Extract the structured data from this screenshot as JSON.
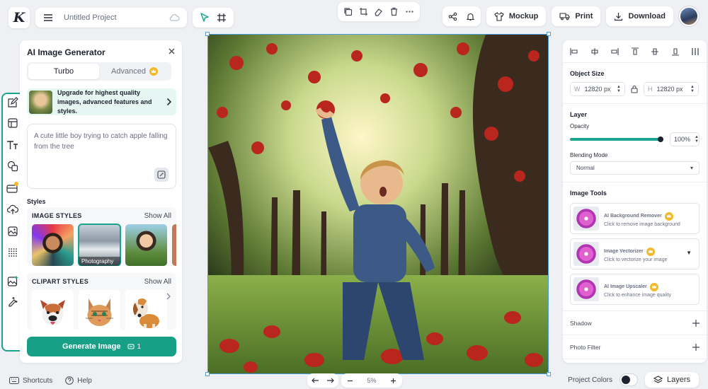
{
  "app": {
    "logo_text": "K",
    "project_name": "Untitled Project"
  },
  "top_actions": {
    "mockup_label": "Mockup",
    "print_label": "Print",
    "download_label": "Download"
  },
  "ai_panel": {
    "title": "AI Image Generator",
    "tabs": [
      {
        "label": "Turbo",
        "active": true
      },
      {
        "label": "Advanced",
        "active": false
      }
    ],
    "upgrade_text": "Upgrade for highest quality images, advanced features and styles.",
    "prompt_text": "A cute little boy trying to catch apple falling from the tree",
    "styles_label": "Styles",
    "image_styles": {
      "title": "IMAGE STYLES",
      "show_all": "Show All",
      "items": [
        {
          "name": "Pop Art"
        },
        {
          "name": "Photography",
          "caption": "Photography",
          "selected": true
        },
        {
          "name": "Anime"
        }
      ]
    },
    "clipart_styles": {
      "title": "CLIPART STYLES",
      "show_all": "Show All",
      "items": [
        {
          "name": "Dog"
        },
        {
          "name": "Cat"
        },
        {
          "name": "Beagle"
        }
      ]
    },
    "generate_label": "Generate Image",
    "credit_count": "1"
  },
  "bottom": {
    "shortcuts_label": "Shortcuts",
    "help_label": "Help",
    "zoom_value": "5%",
    "project_colors_label": "Project Colors",
    "layers_label": "Layers"
  },
  "right_panel": {
    "object_size": {
      "title": "Object Size",
      "w_key": "W",
      "w_value": "12820 px",
      "h_key": "H",
      "h_value": "12820 px"
    },
    "layer": {
      "title": "Layer",
      "opacity_label": "Opacity",
      "opacity_value": "100%",
      "opacity_fraction": 1.0,
      "blend_label": "Blending Mode",
      "blend_value": "Normal"
    },
    "image_tools": {
      "title": "Image Tools",
      "items": [
        {
          "name": "AI Background Remover",
          "desc": "Click to remove image background"
        },
        {
          "name": "Image Vectorizer",
          "desc": "Click to vectorize your image"
        },
        {
          "name": "AI Image Upscaler",
          "desc": "Click to enhance image quality"
        }
      ]
    },
    "shadow_label": "Shadow",
    "photo_filter_label": "Photo Filter"
  },
  "colors": {
    "accent": "#19a58d",
    "button": "#17a085",
    "selection": "#4d9de0",
    "crown": "#f3b928"
  }
}
